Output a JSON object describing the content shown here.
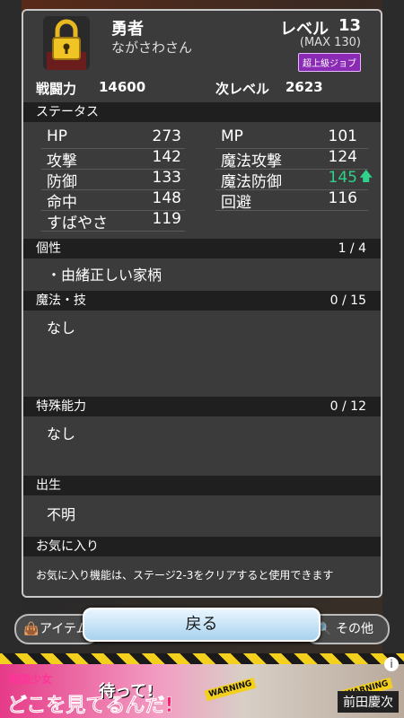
{
  "character": {
    "name": "勇者",
    "player": "ながさわさん",
    "level_label": "レベル",
    "level": "13",
    "max_level": "(MAX 130)",
    "job_badge": "超上級ジョブ",
    "power_label": "戦闘力",
    "power": "14600",
    "next_label": "次レベル",
    "next": "2623"
  },
  "status": {
    "title": "ステータス",
    "left": [
      {
        "label": "HP",
        "value": "273"
      },
      {
        "label": "攻撃",
        "value": "142"
      },
      {
        "label": "防御",
        "value": "133"
      },
      {
        "label": "命中",
        "value": "148"
      },
      {
        "label": "すばやさ",
        "value": "119"
      }
    ],
    "right": [
      {
        "label": "MP",
        "value": "101"
      },
      {
        "label": "魔法攻撃",
        "value": "124"
      },
      {
        "label": "魔法防御",
        "value": "145",
        "up": true
      },
      {
        "label": "回避",
        "value": "116"
      }
    ],
    "up_color": "#2fd28a"
  },
  "personality": {
    "title": "個性",
    "count": "1 / 4",
    "items": [
      "・由緒正しい家柄"
    ]
  },
  "skills": {
    "title": "魔法・技",
    "count": "0 / 15",
    "items": [
      "なし"
    ]
  },
  "abilities": {
    "title": "特殊能力",
    "count": "0 / 12",
    "items": [
      "なし"
    ]
  },
  "origin": {
    "title": "出生",
    "value": "不明"
  },
  "favorite": {
    "title": "お気に入り",
    "note": "お気に入り機能は、ステージ2-3をクリアすると使用できます"
  },
  "buttons": {
    "back": "戻る",
    "items": "アイテム",
    "other": "その他"
  },
  "ad": {
    "logo": "戦国少女",
    "headline": "どこを見てるんだ!",
    "wait": "待って!",
    "warning": "WARNING",
    "name": "前田慶次",
    "info": "i"
  }
}
